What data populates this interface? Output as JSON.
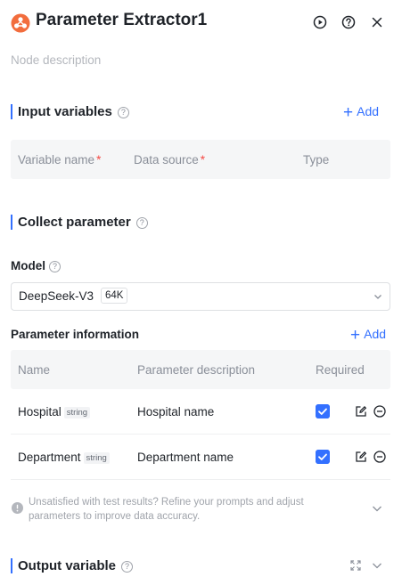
{
  "header": {
    "title": "Parameter Extractor1",
    "description_placeholder": "Node description",
    "icons": [
      "parameter-extractor-logo-icon",
      "run-icon",
      "help-icon",
      "close-icon"
    ]
  },
  "input_variables": {
    "title": "Input variables",
    "add_label": "Add",
    "columns": [
      "Variable name",
      "Data source",
      "Type"
    ]
  },
  "collect_parameter": {
    "title": "Collect parameter"
  },
  "model": {
    "label": "Model",
    "selected": "DeepSeek-V3",
    "context_tag": "64K"
  },
  "parameter_information": {
    "title": "Parameter information",
    "add_label": "Add",
    "columns": [
      "Name",
      "Parameter description",
      "Required"
    ],
    "rows": [
      {
        "name": "Hospital",
        "type": "string",
        "description": "Hospital name",
        "required": true
      },
      {
        "name": "Department",
        "type": "string",
        "description": "Department name",
        "required": true
      }
    ]
  },
  "tip": {
    "text": "Unsatisfied with test results? Refine your prompts and adjust parameters to improve data accuracy."
  },
  "output_variable": {
    "title": "Output variable"
  },
  "colors": {
    "accent": "#3370ff",
    "required_star": "#f54a45",
    "logo": "#f26d3d"
  }
}
